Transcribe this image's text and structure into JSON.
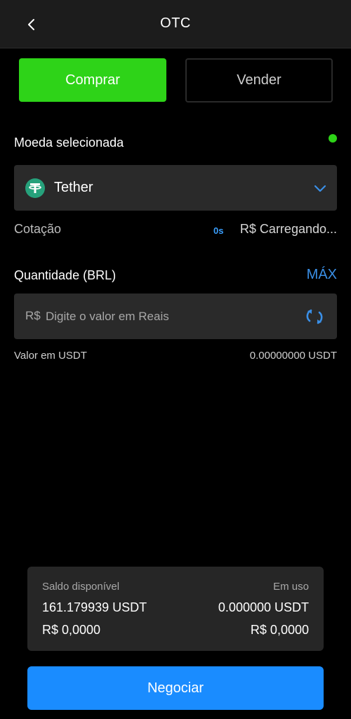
{
  "header": {
    "title": "OTC"
  },
  "trade_toggle": {
    "buy_label": "Comprar",
    "sell_label": "Vender"
  },
  "coin_section": {
    "label": "Moeda selecionada",
    "selected_coin": "Tether"
  },
  "quote": {
    "label": "Cotação",
    "timer": "0s",
    "value": "R$ Carregando..."
  },
  "amount": {
    "label": "Quantidade (BRL)",
    "max_label": "MÁX",
    "prefix": "R$",
    "placeholder": "Digite o valor em Reais",
    "value": ""
  },
  "conversion": {
    "label": "Valor em USDT",
    "value": "0.00000000 USDT"
  },
  "balance": {
    "available_label": "Saldo disponível",
    "available_usdt": "161.179939 USDT",
    "available_brl": "R$ 0,0000",
    "in_use_label": "Em uso",
    "in_use_usdt": "0.000000 USDT",
    "in_use_brl": "R$ 0,0000"
  },
  "actions": {
    "trade_label": "Negociar"
  },
  "colors": {
    "buy_green": "#2ed318",
    "accent_blue": "#1a8cff",
    "tether_green": "#26a17b",
    "background": "#000000",
    "surface": "#2a2a2a"
  },
  "icons": {
    "back": "chevron-left-icon",
    "coin": "tether-icon",
    "dropdown": "chevron-down-icon",
    "swap": "refresh-swap-icon",
    "status": "online-status-dot"
  }
}
